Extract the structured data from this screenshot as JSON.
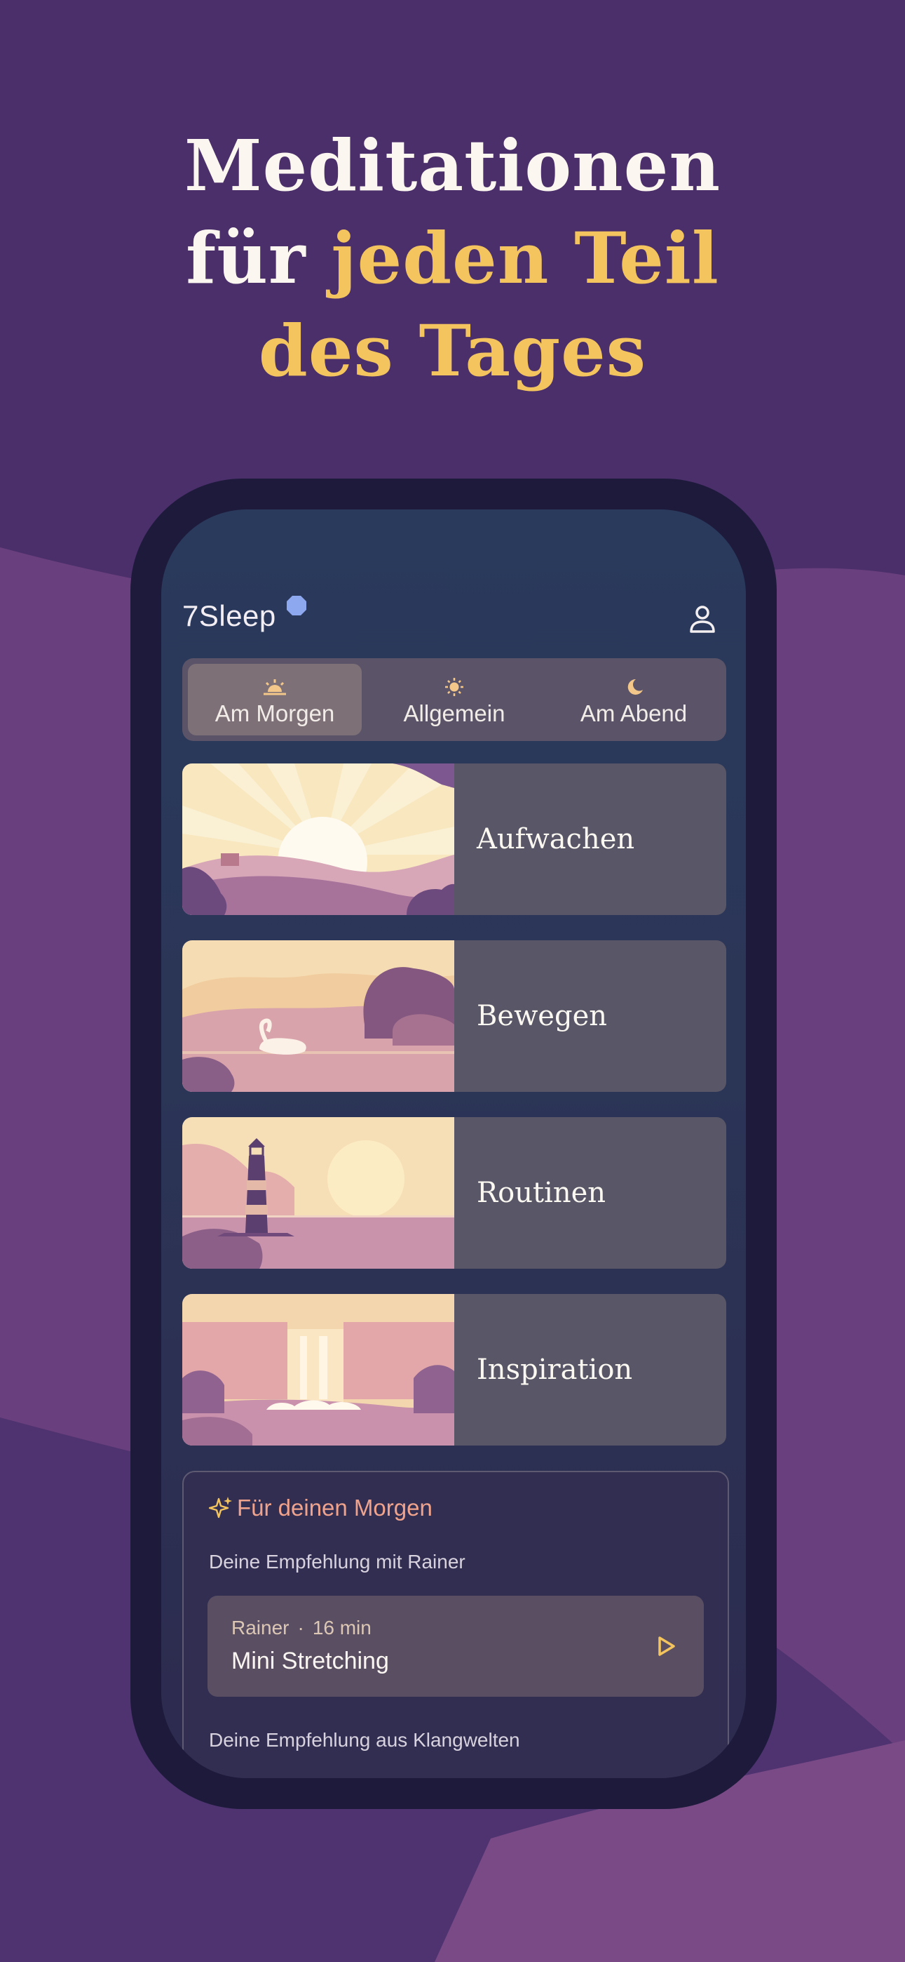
{
  "headline": {
    "line1": "Meditationen",
    "line2_plain": "für ",
    "line2_accent": "jeden Teil",
    "line3_accent": "des Tages"
  },
  "app": {
    "logo_text": "7Sleep",
    "profile_icon": "user-icon"
  },
  "segments": [
    {
      "label": "Am Morgen",
      "icon": "sunrise-icon",
      "active": true
    },
    {
      "label": "Allgemein",
      "icon": "sun-icon",
      "active": false
    },
    {
      "label": "Am Abend",
      "icon": "moon-icon",
      "active": false
    }
  ],
  "categories": [
    {
      "title": "Aufwachen"
    },
    {
      "title": "Bewegen"
    },
    {
      "title": "Routinen"
    },
    {
      "title": "Inspiration"
    }
  ],
  "recommendation": {
    "heading": "Für deinen Morgen",
    "subtitle": "Deine Empfehlung mit Rainer",
    "item": {
      "author": "Rainer",
      "separator": "·",
      "duration": "16 min",
      "title": "Mini Stretching"
    },
    "subtitle2": "Deine Empfehlung aus Klangwelten"
  },
  "colors": {
    "background": "#4a2f6a",
    "accent_yellow": "#f4c55e",
    "accent_coral": "#f0a38c",
    "logo_dot": "#8ea8f0"
  }
}
